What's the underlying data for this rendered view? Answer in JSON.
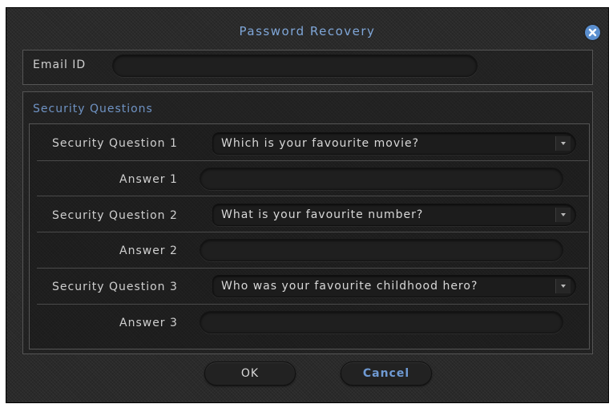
{
  "dialog": {
    "title": "Password Recovery",
    "close_icon": "close-icon"
  },
  "email": {
    "label": "Email ID",
    "value": "",
    "placeholder": ""
  },
  "security": {
    "section_title": "Security Questions",
    "questions": [
      {
        "label": "Security Question 1",
        "selected": "Which is your favourite movie?",
        "answer_label": "Answer 1",
        "answer_value": ""
      },
      {
        "label": "Security Question 2",
        "selected": "What is your favourite number?",
        "answer_label": "Answer 2",
        "answer_value": ""
      },
      {
        "label": "Security Question 3",
        "selected": "Who was your favourite childhood hero?",
        "answer_label": "Answer 3",
        "answer_value": ""
      }
    ]
  },
  "buttons": {
    "ok_label": "OK",
    "cancel_label": "Cancel"
  },
  "colors": {
    "accent": "#5b8fcf",
    "title": "#7fa6d8",
    "background": "#2a2a2a"
  }
}
